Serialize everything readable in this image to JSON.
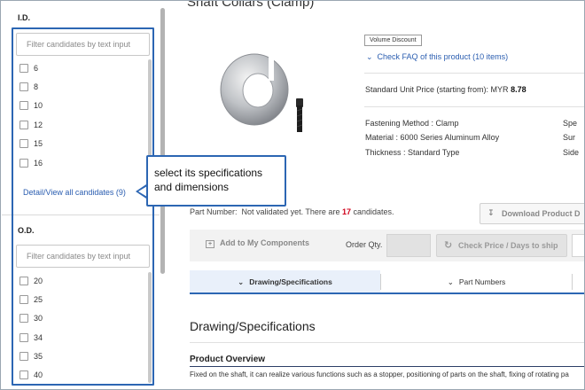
{
  "filters": {
    "id_section": {
      "title": "I.D.",
      "placeholder": "Filter candidates by text input",
      "options": [
        "6",
        "8",
        "10",
        "12",
        "15",
        "16"
      ],
      "detail_link": "Detail/View all candidates (9)"
    },
    "od_section": {
      "title": "O.D.",
      "placeholder": "Filter candidates by text input",
      "options": [
        "20",
        "25",
        "30",
        "34",
        "35",
        "40"
      ]
    }
  },
  "callout": {
    "line1": "select its specifications",
    "line2": "and dimensions"
  },
  "product": {
    "title": "Shaft Collars (Clamp)",
    "badge": "Volume Discount",
    "faq": "Check FAQ of this product (10 items)",
    "price_label": "Standard Unit Price (starting from): MYR",
    "price_value": "8.78",
    "specs": [
      "Fastening Method : Clamp",
      "Material : 6000 Series Aluminum Alloy",
      "Thickness : Standard Type"
    ],
    "specs_right": [
      "Spe",
      "Sur",
      "Side"
    ]
  },
  "part_number": {
    "label": "Part Number:",
    "status": "Not validated yet. There are",
    "count": "17",
    "suffix": "candidates."
  },
  "actions": {
    "download": "Download Product D",
    "add_components": "Add to My Components",
    "order_qty": "Order Qty.",
    "check_price": "Check Price / Days to ship"
  },
  "tabs": [
    "Drawing/Specifications",
    "Part Numbers"
  ],
  "content": {
    "heading": "Drawing/Specifications",
    "overview": "Product Overview",
    "description": "Fixed on the shaft, it can realize various functions such as a stopper, positioning of parts on the shaft, fixing of rotating pa"
  },
  "colors": {
    "accent": "#2c66b3",
    "link": "#2a5db0",
    "count_red": "#d0021b"
  }
}
